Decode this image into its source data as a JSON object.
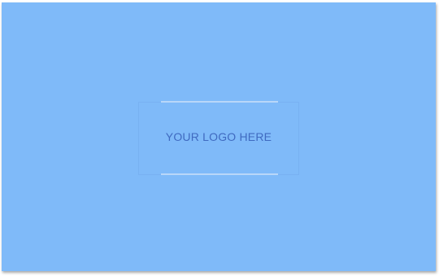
{
  "logo": {
    "text": "YOUR LOGO HERE"
  },
  "colors": {
    "background": "#7fbaf9",
    "logo_text": "#3f6ac0",
    "rule": "#b8d7f9"
  }
}
